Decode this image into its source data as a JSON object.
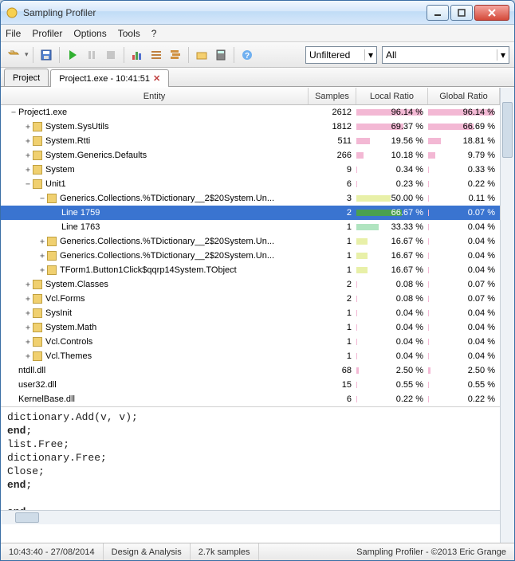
{
  "window": {
    "title": "Sampling Profiler"
  },
  "menu": {
    "file": "File",
    "profiler": "Profiler",
    "options": "Options",
    "tools": "Tools",
    "help": "?"
  },
  "toolbar": {
    "filter_combo": "Unfiltered",
    "all_combo": "All"
  },
  "tabs": [
    {
      "label": "Project",
      "closeable": false,
      "active": false
    },
    {
      "label": "Project1.exe - 10:41:51",
      "closeable": true,
      "active": true
    }
  ],
  "grid": {
    "headers": {
      "entity": "Entity",
      "samples": "Samples",
      "local": "Local Ratio",
      "global": "Global Ratio"
    },
    "rows": [
      {
        "depth": 0,
        "expander": "−",
        "label": "Project1.exe",
        "samples": "2612",
        "local": "96.14 %",
        "lbar": 96,
        "lcolor": "#f3b8d4",
        "global": "96.14 %",
        "gbar": 96,
        "gcolor": "#f3b8d4",
        "sel": false
      },
      {
        "depth": 1,
        "expander": "+",
        "label": "System.SysUtils",
        "samples": "1812",
        "local": "69.37 %",
        "lbar": 69,
        "lcolor": "#f3b8d4",
        "global": "66.69 %",
        "gbar": 67,
        "gcolor": "#f3b8d4",
        "sel": false
      },
      {
        "depth": 1,
        "expander": "+",
        "label": "System.Rtti",
        "samples": "511",
        "local": "19.56 %",
        "lbar": 20,
        "lcolor": "#f3b8d4",
        "global": "18.81 %",
        "gbar": 19,
        "gcolor": "#f3b8d4",
        "sel": false
      },
      {
        "depth": 1,
        "expander": "+",
        "label": "System.Generics.Defaults",
        "samples": "266",
        "local": "10.18 %",
        "lbar": 10,
        "lcolor": "#f3b8d4",
        "global": "9.79 %",
        "gbar": 10,
        "gcolor": "#f3b8d4",
        "sel": false
      },
      {
        "depth": 1,
        "expander": "+",
        "label": "System",
        "samples": "9",
        "local": "0.34 %",
        "lbar": 1,
        "lcolor": "#f3b8d4",
        "global": "0.33 %",
        "gbar": 1,
        "gcolor": "#f3b8d4",
        "sel": false
      },
      {
        "depth": 1,
        "expander": "−",
        "label": "Unit1",
        "samples": "6",
        "local": "0.23 %",
        "lbar": 1,
        "lcolor": "#f3b8d4",
        "global": "0.22 %",
        "gbar": 1,
        "gcolor": "#f3b8d4",
        "sel": false
      },
      {
        "depth": 2,
        "expander": "−",
        "label": "Generics.Collections.%TDictionary__2$20System.Un...",
        "samples": "3",
        "local": "50.00 %",
        "lbar": 50,
        "lcolor": "#e8f0a8",
        "global": "0.11 %",
        "gbar": 1,
        "lcolor2": "",
        "sel": false
      },
      {
        "depth": 3,
        "expander": "",
        "label": "Line 1759",
        "samples": "2",
        "local": "66.67 %",
        "lbar": 67,
        "lcolor": "#4aa050",
        "global": "0.07 %",
        "gbar": 1,
        "sel": true
      },
      {
        "depth": 3,
        "expander": "",
        "label": "Line 1763",
        "samples": "1",
        "local": "33.33 %",
        "lbar": 33,
        "lcolor": "#b0e4c0",
        "global": "0.04 %",
        "gbar": 1,
        "sel": false
      },
      {
        "depth": 2,
        "expander": "+",
        "label": "Generics.Collections.%TDictionary__2$20System.Un...",
        "samples": "1",
        "local": "16.67 %",
        "lbar": 17,
        "lcolor": "#e8f0a8",
        "global": "0.04 %",
        "gbar": 1,
        "sel": false
      },
      {
        "depth": 2,
        "expander": "+",
        "label": "Generics.Collections.%TDictionary__2$20System.Un...",
        "samples": "1",
        "local": "16.67 %",
        "lbar": 17,
        "lcolor": "#e8f0a8",
        "global": "0.04 %",
        "gbar": 1,
        "sel": false
      },
      {
        "depth": 2,
        "expander": "+",
        "label": "TForm1.Button1Click$qqrp14System.TObject",
        "samples": "1",
        "local": "16.67 %",
        "lbar": 17,
        "lcolor": "#e8f0a8",
        "global": "0.04 %",
        "gbar": 1,
        "sel": false
      },
      {
        "depth": 1,
        "expander": "+",
        "label": "System.Classes",
        "samples": "2",
        "local": "0.08 %",
        "lbar": 1,
        "lcolor": "#f3b8d4",
        "global": "0.07 %",
        "gbar": 1,
        "sel": false
      },
      {
        "depth": 1,
        "expander": "+",
        "label": "Vcl.Forms",
        "samples": "2",
        "local": "0.08 %",
        "lbar": 1,
        "lcolor": "#f3b8d4",
        "global": "0.07 %",
        "gbar": 1,
        "sel": false
      },
      {
        "depth": 1,
        "expander": "+",
        "label": "SysInit",
        "samples": "1",
        "local": "0.04 %",
        "lbar": 1,
        "lcolor": "#f3b8d4",
        "global": "0.04 %",
        "gbar": 1,
        "sel": false
      },
      {
        "depth": 1,
        "expander": "+",
        "label": "System.Math",
        "samples": "1",
        "local": "0.04 %",
        "lbar": 1,
        "lcolor": "#f3b8d4",
        "global": "0.04 %",
        "gbar": 1,
        "sel": false
      },
      {
        "depth": 1,
        "expander": "+",
        "label": "Vcl.Controls",
        "samples": "1",
        "local": "0.04 %",
        "lbar": 1,
        "lcolor": "#f3b8d4",
        "global": "0.04 %",
        "gbar": 1,
        "sel": false
      },
      {
        "depth": 1,
        "expander": "+",
        "label": "Vcl.Themes",
        "samples": "1",
        "local": "0.04 %",
        "lbar": 1,
        "lcolor": "#f3b8d4",
        "global": "0.04 %",
        "gbar": 1,
        "sel": false
      },
      {
        "depth": 0,
        "expander": "",
        "label": "ntdll.dll",
        "samples": "68",
        "local": "2.50 %",
        "lbar": 3,
        "lcolor": "#f3b8d4",
        "global": "2.50 %",
        "gbar": 3,
        "sel": false
      },
      {
        "depth": 0,
        "expander": "",
        "label": "user32.dll",
        "samples": "15",
        "local": "0.55 %",
        "lbar": 1,
        "lcolor": "#f3b8d4",
        "global": "0.55 %",
        "gbar": 1,
        "sel": false
      },
      {
        "depth": 0,
        "expander": "",
        "label": "KernelBase.dll",
        "samples": "6",
        "local": "0.22 %",
        "lbar": 1,
        "lcolor": "#f3b8d4",
        "global": "0.22 %",
        "gbar": 1,
        "sel": false
      }
    ]
  },
  "source": {
    "lines": [
      "      dictionary.Add(v, v);",
      "    end;",
      "  list.Free;",
      "  dictionary.Free;",
      "  Close;",
      "end;",
      "",
      "end."
    ]
  },
  "status": {
    "time": "10:43:40 - 27/08/2014",
    "mode": "Design & Analysis",
    "samples": "2.7k samples",
    "credit": "Sampling Profiler - ©2013 Eric Grange"
  }
}
